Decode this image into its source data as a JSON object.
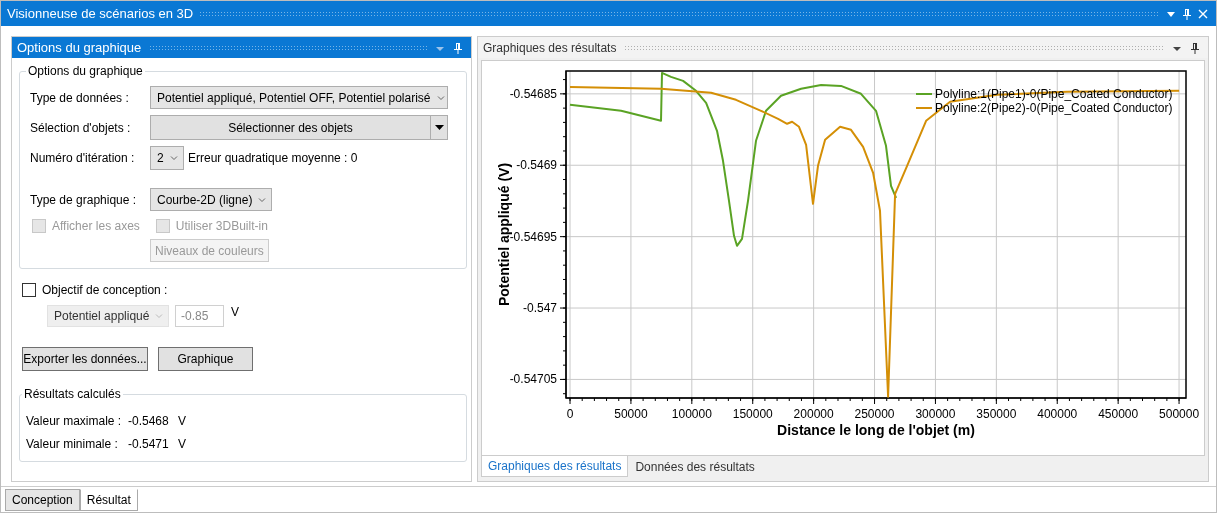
{
  "window": {
    "title": "Visionneuse de scénarios en 3D"
  },
  "options_panel": {
    "title": "Options du graphique",
    "group_title": "Options du graphique",
    "data_type": {
      "label": "Type de données :",
      "value": "Potentiel appliqué, Potentiel OFF, Potentiel polarisé"
    },
    "object_selection": {
      "label": "Sélection d'objets :",
      "button": "Sélectionner des objets"
    },
    "iteration": {
      "label": "Numéro d'itération :",
      "value": "2",
      "error": "Erreur quadratique moyenne : 0"
    },
    "chart_type": {
      "label": "Type de graphique :",
      "value": "Courbe-2D (ligne)"
    },
    "checkboxes": [
      {
        "label": "Afficher les axes",
        "checked": false,
        "disabled": true
      },
      {
        "label": "Utiliser 3DBuilt-in",
        "checked": false,
        "disabled": true
      }
    ],
    "color_levels_button": {
      "label": "Niveaux de couleurs",
      "disabled": true
    },
    "design_objective": {
      "label": "Objectif de conception :",
      "checked": false,
      "type_value": "Potentiel appliqué",
      "target_value": "-0.85",
      "unit": "V"
    },
    "buttons": [
      "Exporter les données...",
      "Graphique"
    ],
    "results": {
      "title": "Résultats calculés",
      "rows": [
        {
          "label": "Valeur maximale :",
          "value": "-0.5468",
          "unit": "V"
        },
        {
          "label": "Valeur minimale :",
          "value": "-0.5471",
          "unit": "V"
        }
      ]
    }
  },
  "results_panel": {
    "title": "Graphiques des résultats",
    "chart_data": {
      "type": "line",
      "grid": true,
      "legend": true,
      "xlabel": "Distance le long de l'objet (m)",
      "ylabel": "Potentiel appliqué (V)",
      "xlim": [
        -3300,
        505700
      ],
      "ylim": [
        -0.547063,
        -0.546834
      ],
      "xticks": [
        0,
        50000,
        100000,
        150000,
        200000,
        250000,
        300000,
        350000,
        400000,
        450000,
        500000
      ],
      "yticks": [
        -0.54705,
        -0.547,
        -0.54695,
        -0.5469,
        -0.54685
      ],
      "series": [
        {
          "name": "Polyline:1(Pipe1)-0(Pipe_Coated Conductor)",
          "color": "#5aa324",
          "x": [
            0,
            41900,
            74700,
            75500,
            82900,
            92800,
            103400,
            111700,
            120700,
            125600,
            130500,
            134600,
            137100,
            141200,
            146100,
            152700,
            160900,
            173200,
            189700,
            206100,
            222500,
            238900,
            251200,
            259400,
            263500,
            267700
          ],
          "values": [
            -0.5468577,
            -0.5468619,
            -0.5468689,
            -0.5468353,
            -0.5468381,
            -0.5468409,
            -0.5468479,
            -0.5468563,
            -0.5468759,
            -0.5468969,
            -0.5469249,
            -0.5469494,
            -0.5469564,
            -0.5469515,
            -0.5469249,
            -0.5468829,
            -0.5468619,
            -0.5468514,
            -0.5468465,
            -0.5468437,
            -0.5468444,
            -0.54685,
            -0.5468619,
            -0.5468864,
            -0.5469144,
            -0.5469228
          ]
        },
        {
          "name": "Polyline:2(Pipe2)-0(Pipe_Coated Conductor)",
          "color": "#d48f06",
          "x": [
            0,
            74700,
            115800,
            136300,
            156800,
            170800,
            178200,
            182300,
            188000,
            193800,
            199500,
            203600,
            209400,
            221700,
            230700,
            240600,
            248800,
            254500,
            261100,
            266900,
            276700,
            292300,
            312000,
            350600,
            408100,
            500000
          ],
          "values": [
            -0.5468451,
            -0.5468465,
            -0.5468493,
            -0.5468542,
            -0.5468619,
            -0.5468675,
            -0.546871,
            -0.5468696,
            -0.5468731,
            -0.5468857,
            -0.546927,
            -0.5469004,
            -0.5468822,
            -0.5468731,
            -0.5468752,
            -0.5468871,
            -0.5469053,
            -0.5469319,
            -0.5470621,
            -0.54692,
            -0.5469004,
            -0.5468689,
            -0.5468556,
            -0.5468507,
            -0.5468486,
            -0.5468479
          ]
        }
      ]
    },
    "tabs": [
      {
        "label": "Graphiques des résultats",
        "selected": true
      },
      {
        "label": "Données des résultats",
        "selected": false
      }
    ]
  },
  "bottom_tabs": [
    {
      "label": "Conception",
      "selected": false
    },
    {
      "label": "Résultat",
      "selected": true
    }
  ]
}
